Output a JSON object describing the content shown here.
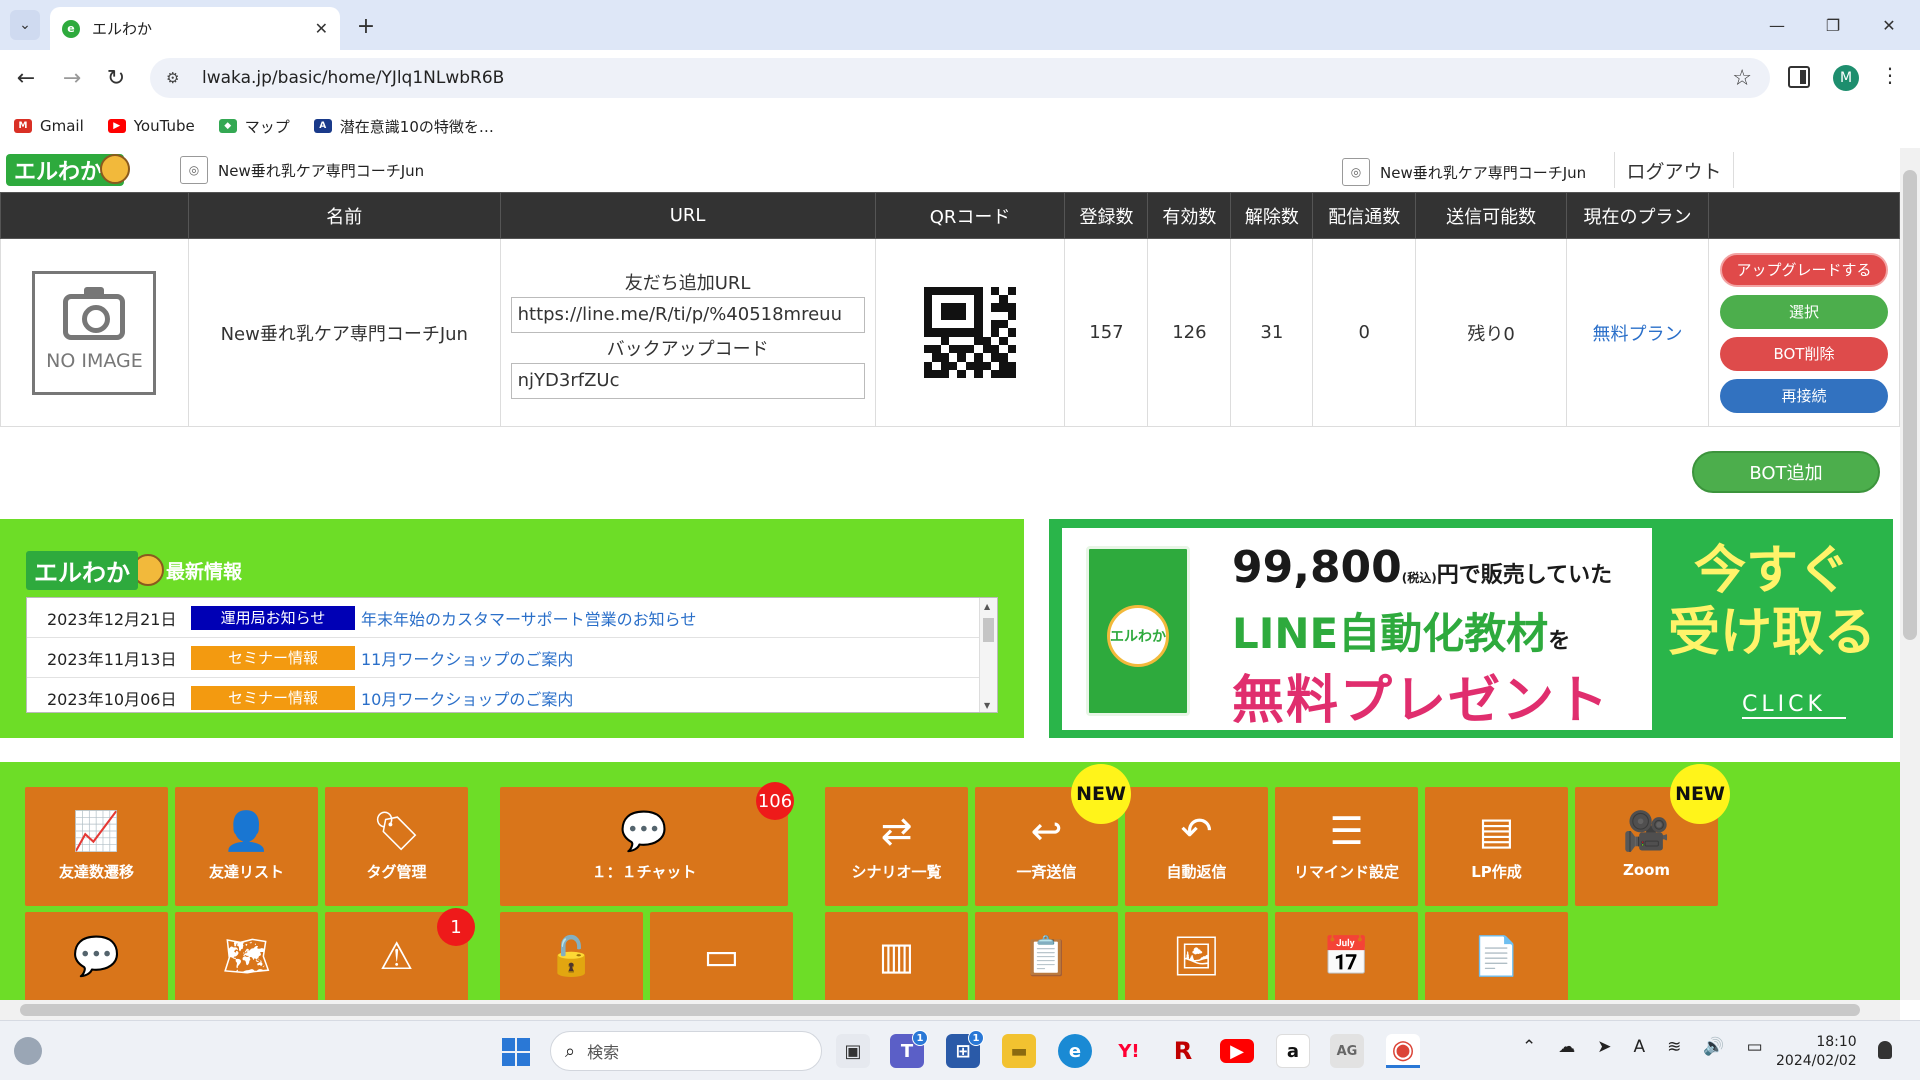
{
  "browser": {
    "tab_title": "エルわか",
    "tab_favicon_letter": "e",
    "url": "lwaka.jp/basic/home/YJlq1NLwbR6B",
    "profile_initial": "M",
    "bookmarks": [
      {
        "label": "Gmail",
        "color": "#d93025",
        "icon_letter": "M"
      },
      {
        "label": "YouTube",
        "color": "#ff0000",
        "icon_letter": "▶"
      },
      {
        "label": "マップ",
        "color": "#34a853",
        "icon_letter": "◆"
      },
      {
        "label": "潜在意識10の特徴を…",
        "color": "#1a3a8a",
        "icon_letter": "A"
      }
    ]
  },
  "header": {
    "logo_text": "エルわか",
    "account_name_left": "New垂れ乳ケア専門コーチJun",
    "account_name_right": "New垂れ乳ケア専門コーチJun",
    "logout_label": "ログアウト"
  },
  "table": {
    "columns": [
      "",
      "名前",
      "URL",
      "QRコード",
      "登録数",
      "有効数",
      "解除数",
      "配信通数",
      "送信可能数",
      "現在のプラン",
      ""
    ],
    "row": {
      "image_placeholder": "NO IMAGE",
      "name": "New垂れ乳ケア専門コーチJun",
      "friend_url_label": "友だち追加URL",
      "friend_url_value": "https://line.me/R/ti/p/%40518mreuu",
      "backup_code_label": "バックアップコード",
      "backup_code_value": "njYD3rfZUc",
      "registered": "157",
      "active": "126",
      "unsubscribed": "31",
      "deliveries": "0",
      "sendable": "残り0",
      "plan": "無料プラン",
      "actions": {
        "upgrade": "アップグレードする",
        "select": "選択",
        "delete": "BOT削除",
        "reconnect": "再接続"
      }
    }
  },
  "bot_add_label": "BOT追加",
  "news": {
    "logo_text": "エルわか",
    "title": "最新情報",
    "items": [
      {
        "date": "2023年12月21日",
        "badge": "運用局お知らせ",
        "badge_color": "#0000b5",
        "title": "年末年始のカスタマーサポート営業のお知らせ"
      },
      {
        "date": "2023年11月13日",
        "badge": "セミナー情報",
        "badge_color": "#f39a10",
        "title": "11月ワークショップのご案内"
      },
      {
        "date": "2023年10月06日",
        "badge": "セミナー情報",
        "badge_color": "#f39a10",
        "title": "10月ワークショップのご案内"
      }
    ]
  },
  "banner": {
    "book_label": "エルわか",
    "price": "99,800",
    "tax_note": "(税込)",
    "line1_suffix": "円で販売していた",
    "line2_main": "LINE自動化教材",
    "line2_suffix": "を",
    "line3": "無料プレゼント",
    "cta_line1": "今すぐ",
    "cta_line2": "受け取る",
    "click_label": "CLICK"
  },
  "menu_tiles_row1": [
    {
      "label": "友達数遷移",
      "icon": "chart-line-icon",
      "glyph": "📈"
    },
    {
      "label": "友達リスト",
      "icon": "user-icon",
      "glyph": "👤"
    },
    {
      "label": "タグ管理",
      "icon": "tags-icon",
      "glyph": "🏷"
    },
    {
      "label": "１：１チャット",
      "icon": "chat-bubble-icon",
      "glyph": "💬",
      "badge": "106"
    },
    {
      "label": "シナリオ一覧",
      "icon": "shuffle-icon",
      "glyph": "⇄"
    },
    {
      "label": "一斉送信",
      "icon": "reply-icon",
      "glyph": "↩",
      "new": "NEW"
    },
    {
      "label": "自動返信",
      "icon": "undo-icon",
      "glyph": "↶"
    },
    {
      "label": "リマインド設定",
      "icon": "list-icon",
      "glyph": "☰"
    },
    {
      "label": "LP作成",
      "icon": "webpage-icon",
      "glyph": "▤"
    },
    {
      "label": "Zoom",
      "icon": "video-camera-icon",
      "glyph": "🎥",
      "new": "NEW"
    }
  ],
  "menu_tiles_row2": [
    {
      "icon": "comment-icon",
      "glyph": "💬"
    },
    {
      "icon": "map-icon",
      "glyph": "🗺"
    },
    {
      "icon": "warning-icon",
      "glyph": "⚠",
      "badge": "1"
    },
    {
      "icon": "unlock-icon",
      "glyph": "🔓"
    },
    {
      "icon": "card-icon",
      "glyph": "▭"
    },
    {
      "icon": "columns-icon",
      "glyph": "▥"
    },
    {
      "icon": "clipboard-edit-icon",
      "glyph": "📋"
    },
    {
      "icon": "image-icon",
      "glyph": "🖼"
    },
    {
      "icon": "calendar-icon",
      "glyph": "📅"
    },
    {
      "icon": "document-icon",
      "glyph": "📄"
    }
  ],
  "taskbar": {
    "search_placeholder": "検索",
    "time": "18:10",
    "date": "2024/02/02",
    "apps": [
      {
        "name": "task-view-icon",
        "color": "#333333",
        "glyph": "▣"
      },
      {
        "name": "teams-icon",
        "color": "#5b5fc7",
        "glyph": "T",
        "badge": "1"
      },
      {
        "name": "store-icon",
        "color": "#2a5aa8",
        "glyph": "⊞",
        "badge": "1"
      },
      {
        "name": "file-explorer-icon",
        "color": "#f2c230",
        "glyph": "▬"
      },
      {
        "name": "edge-icon",
        "color": "#1a8ad4",
        "glyph": "e"
      },
      {
        "name": "yahoo-icon",
        "color": "#ffffff",
        "glyph": "Y!"
      },
      {
        "name": "rakuten-icon",
        "color": "#ffffff",
        "glyph": "R"
      },
      {
        "name": "youtube-icon",
        "color": "#ff0000",
        "glyph": "▶"
      },
      {
        "name": "amazon-icon",
        "color": "#ffffff",
        "glyph": "a"
      },
      {
        "name": "ag-icon",
        "color": "#dddddd",
        "glyph": "AG"
      },
      {
        "name": "chrome-icon",
        "color": "#ffffff",
        "glyph": "◉"
      }
    ]
  }
}
